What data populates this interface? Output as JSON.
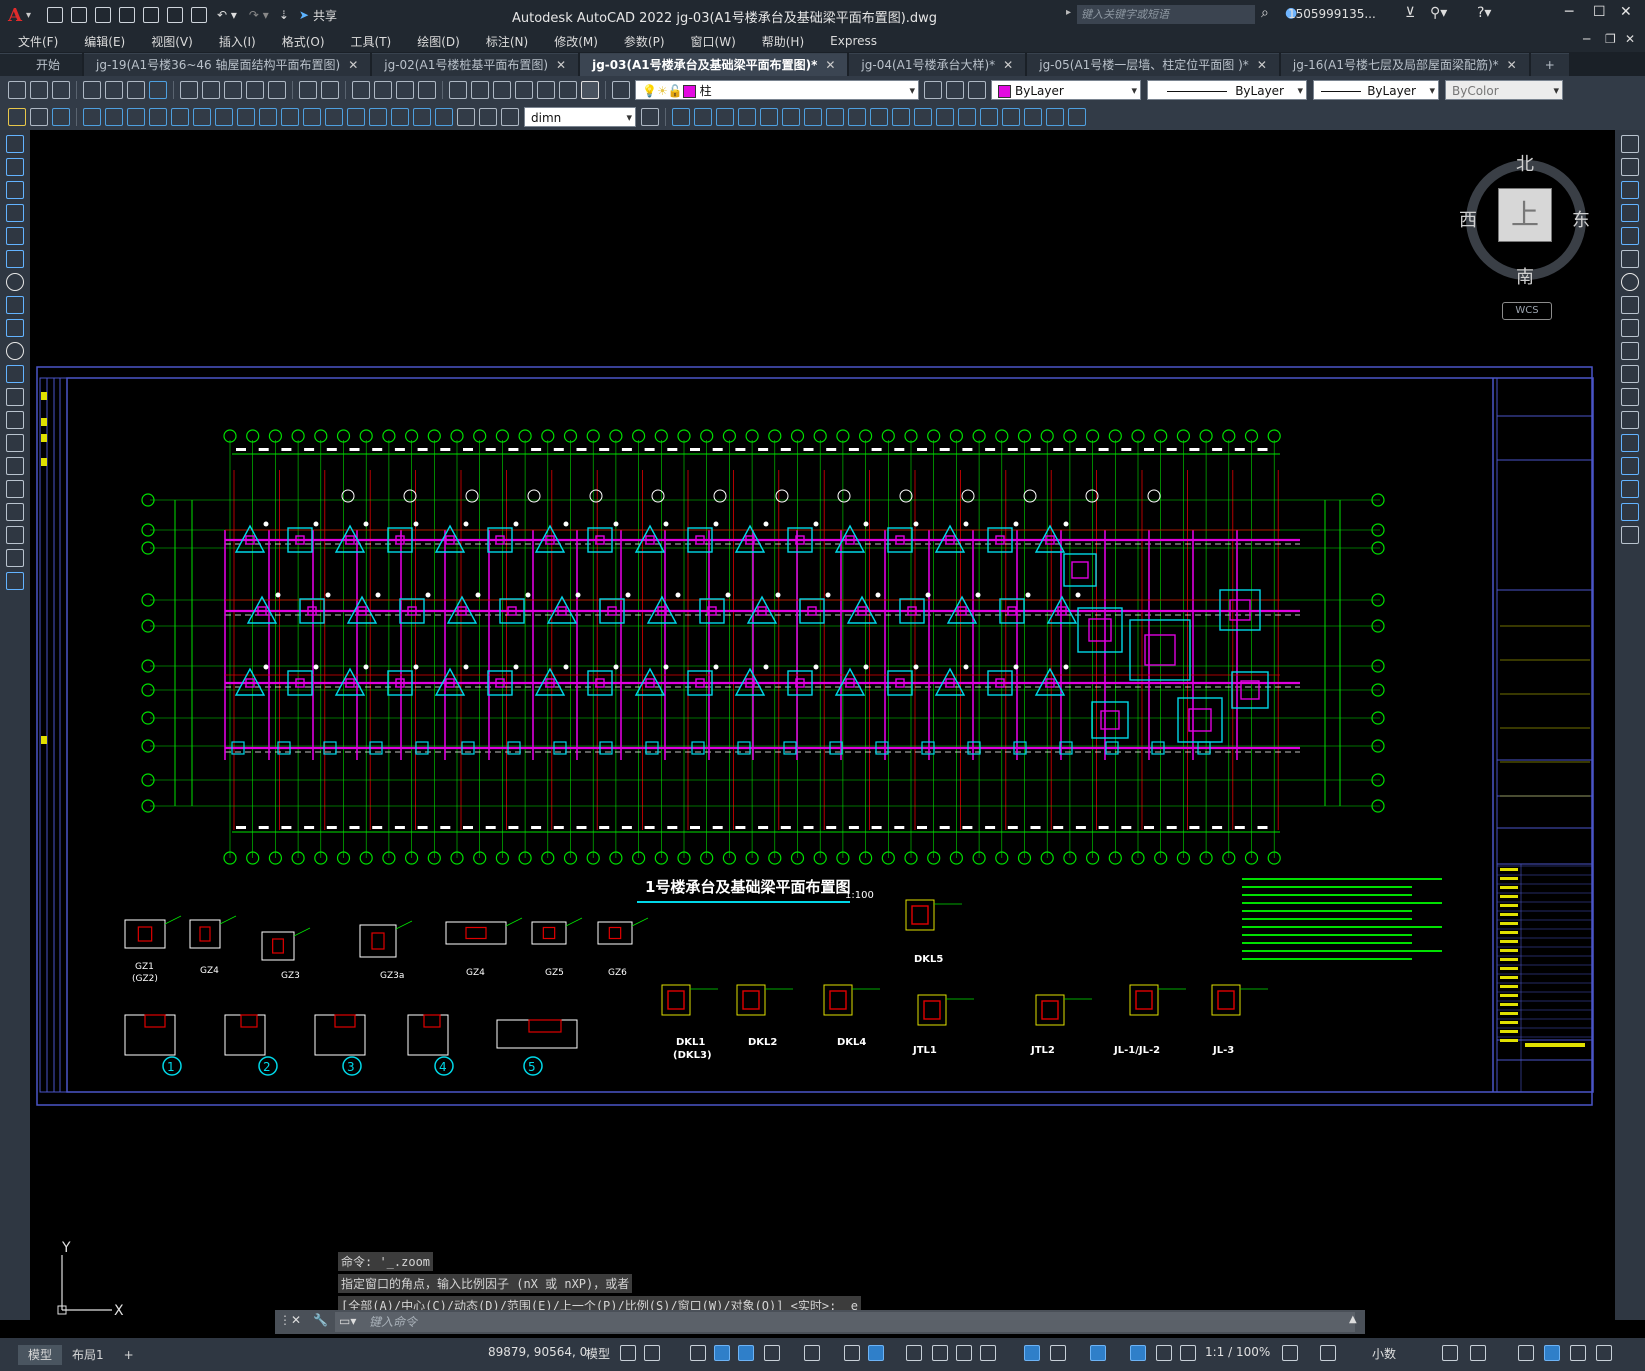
{
  "app": {
    "title": "Autodesk AutoCAD 2022    jg-03(A1号楼承台及基础梁平面布置图).dwg",
    "share": "共享",
    "search_placeholder": "键入关键字或短语",
    "user": "1505999135...",
    "logo": "A"
  },
  "menus": [
    "文件(F)",
    "编辑(E)",
    "视图(V)",
    "插入(I)",
    "格式(O)",
    "工具(T)",
    "绘图(D)",
    "标注(N)",
    "修改(M)",
    "参数(P)",
    "窗口(W)",
    "帮助(H)",
    "Express"
  ],
  "tabs": [
    {
      "label": "开始",
      "active": false
    },
    {
      "label": "jg-19(A1号楼36~46 轴屋面结构平面布置图)",
      "active": false
    },
    {
      "label": "jg-02(A1号楼桩基平面布置图)",
      "active": false
    },
    {
      "label": "jg-03(A1号楼承台及基础梁平面布置图)*",
      "active": true
    },
    {
      "label": "jg-04(A1号楼承台大样)*",
      "active": false
    },
    {
      "label": "jg-05(A1号楼一层墙、柱定位平面图 )*",
      "active": false
    },
    {
      "label": "jg-16(A1号楼七层及局部屋面梁配筋)*",
      "active": false
    }
  ],
  "layer_combo": "柱",
  "color_combo": "ByLayer",
  "linetype_combo": "ByLayer",
  "lineweight_combo": "ByLayer",
  "plotstyle_combo": "ByColor",
  "dimstyle_combo": "dimn",
  "colors": {
    "layer_swatch": "#e20ae0",
    "green": "#00e000",
    "red": "#e00000",
    "magenta": "#e000e0",
    "yellow": "#e0e000",
    "cyan": "#00d8e8",
    "frame": "#4a55c8"
  },
  "viewcube": {
    "n": "北",
    "s": "南",
    "e": "东",
    "w": "西",
    "top": "上",
    "wcs": "WCS"
  },
  "drawing": {
    "title": "1号楼承台及基础梁平面布置图",
    "scale": "1:100",
    "gz_labels": [
      "GZ1",
      "GZ4",
      "GZ3",
      "GZ3a",
      "GZ4",
      "GZ5",
      "GZ6"
    ],
    "gz1_sub": "(GZ2)",
    "detail_nums": [
      "1",
      "2",
      "3",
      "4",
      "5"
    ],
    "beam_labels": [
      "DKL1",
      "DKL2",
      "DKL4",
      "JTL1",
      "JTL2",
      "JL-1/JL-2",
      "JL-3",
      "DKL5"
    ],
    "dkl1_sub": "(DKL3)"
  },
  "command": {
    "history": [
      "命令: '_.zoom",
      "指定窗口的角点，输入比例因子 (nX 或 nXP)，或者",
      "[全部(A)/中心(C)/动态(D)/范围(E)/上一个(P)/比例(S)/窗口(W)/对象(O)] <实时>: _e"
    ],
    "placeholder": "键入命令"
  },
  "status": {
    "model_tab": "模型",
    "layout_tab": "布局1",
    "add": "+",
    "coords": "89879, 90564, 0",
    "space": "模型",
    "scale": "1:1 / 100%",
    "units": "小数"
  }
}
